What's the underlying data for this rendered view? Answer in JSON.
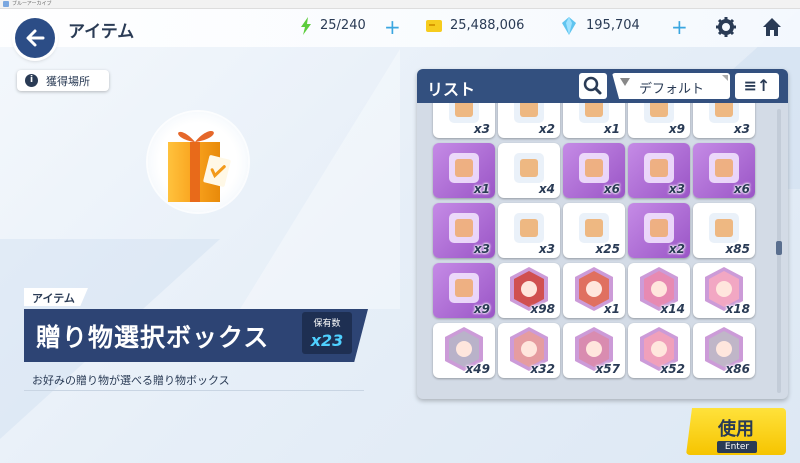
{
  "window": {
    "title": "ブルーアーカイブ"
  },
  "header": {
    "title": "アイテム",
    "ap": "25/240",
    "credits": "25,488,006",
    "gems": "195,704"
  },
  "source_button": {
    "label": "獲得場所"
  },
  "item": {
    "category": "アイテム",
    "name": "贈り物選択ボックス",
    "owned_label": "保有数",
    "owned_value": "x23",
    "description": "お好みの贈り物が選べる贈り物ボックス"
  },
  "list": {
    "title": "リスト",
    "sort": "デフォルト",
    "rows": [
      [
        {
          "qty": "x3",
          "icon": "paper-stack-icon",
          "style": "white"
        },
        {
          "qty": "x2",
          "icon": "charm-icon",
          "style": "white"
        },
        {
          "qty": "x1",
          "icon": "pin-icon",
          "style": "white"
        },
        {
          "qty": "x9",
          "icon": "book-icon",
          "style": "white"
        },
        {
          "qty": "x3",
          "icon": "doll-icon",
          "style": "white"
        }
      ],
      [
        {
          "qty": "x1",
          "icon": "candy-jar-icon",
          "style": "purple"
        },
        {
          "qty": "x4",
          "icon": "bonsai-tree-icon",
          "style": "white"
        },
        {
          "qty": "x6",
          "icon": "sewing-kit-icon",
          "style": "purple"
        },
        {
          "qty": "x3",
          "icon": "tickets-icon",
          "style": "purple"
        },
        {
          "qty": "x6",
          "icon": "camera-icon",
          "style": "purple"
        }
      ],
      [
        {
          "qty": "x3",
          "icon": "game-console-icon",
          "style": "purple"
        },
        {
          "qty": "x3",
          "icon": "rose-bouquet-icon",
          "style": "white"
        },
        {
          "qty": "x25",
          "icon": "ticket-icon",
          "style": "white"
        },
        {
          "qty": "x2",
          "icon": "ticket-card-icon",
          "style": "purple"
        },
        {
          "qty": "x85",
          "icon": "document-icon",
          "style": "white"
        }
      ],
      [
        {
          "qty": "x9",
          "icon": "map-icon",
          "style": "purple"
        },
        {
          "qty": "x98",
          "icon": "student-portrait-icon",
          "style": "white"
        },
        {
          "qty": "x1",
          "icon": "student-portrait-icon",
          "style": "white"
        },
        {
          "qty": "x14",
          "icon": "student-portrait-icon",
          "style": "white"
        },
        {
          "qty": "x18",
          "icon": "student-portrait-icon",
          "style": "white"
        }
      ],
      [
        {
          "qty": "x49",
          "icon": "student-portrait-icon",
          "style": "white"
        },
        {
          "qty": "x32",
          "icon": "student-portrait-icon",
          "style": "white"
        },
        {
          "qty": "x57",
          "icon": "student-portrait-icon",
          "style": "white"
        },
        {
          "qty": "x52",
          "icon": "student-portrait-icon",
          "style": "white"
        },
        {
          "qty": "x86",
          "icon": "student-portrait-icon",
          "style": "white"
        }
      ]
    ]
  },
  "use_button": {
    "label": "使用",
    "key": "Enter"
  },
  "colors": {
    "navy": "#2d4474",
    "list_header": "#33507f",
    "accent_blue": "#3aa6e0",
    "purple_tile": "#b06ed9",
    "yellow_button": "#f6c400"
  }
}
